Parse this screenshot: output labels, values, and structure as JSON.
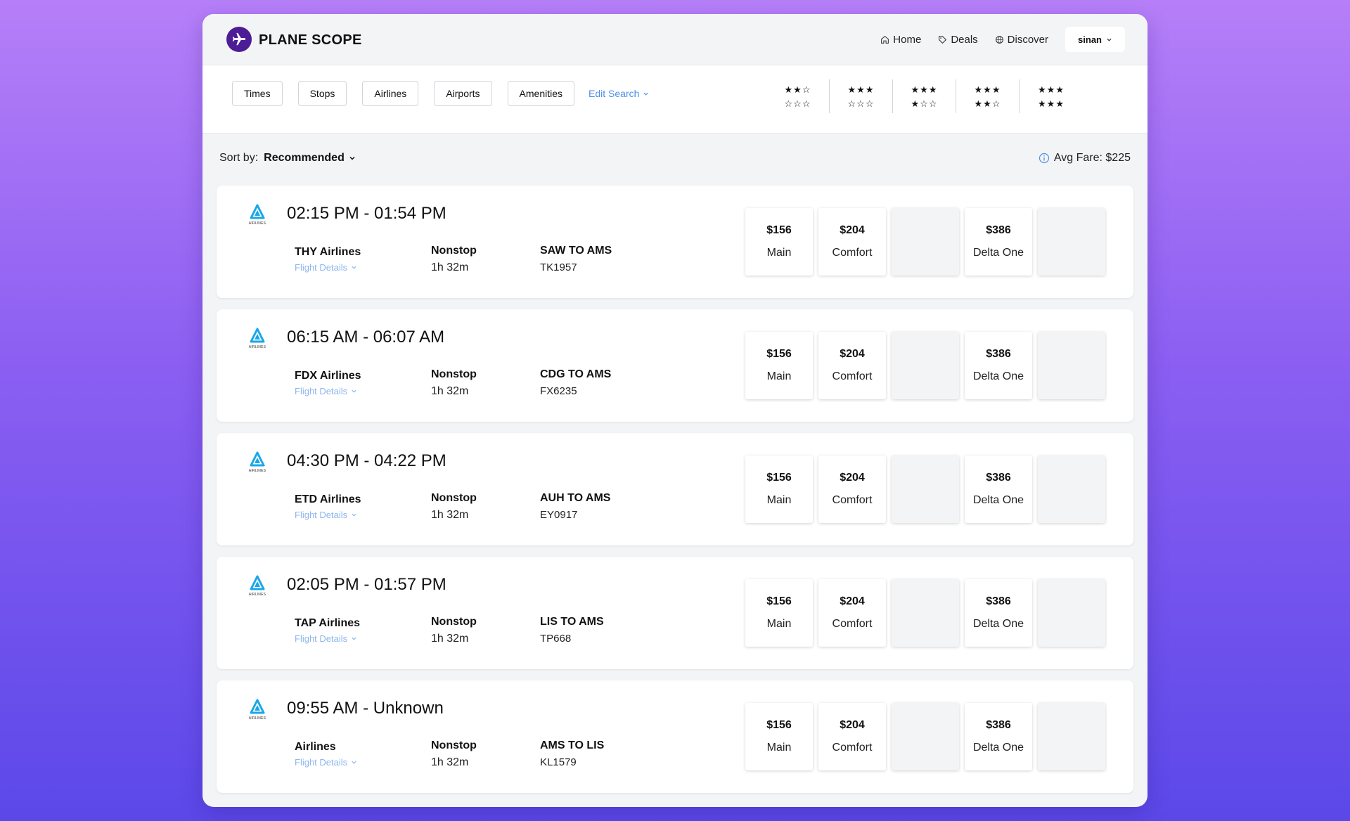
{
  "app": {
    "brand": "PLANE SCOPE"
  },
  "nav": {
    "home": "Home",
    "deals": "Deals",
    "discover": "Discover",
    "user": "sinan"
  },
  "filters": {
    "times": "Times",
    "stops": "Stops",
    "airlines": "Airlines",
    "airports": "Airports",
    "amenities": "Amenities",
    "edit_search": "Edit Search"
  },
  "star_ratings": [
    {
      "top": "★★☆",
      "bottom": "☆☆☆"
    },
    {
      "top": "★★★",
      "bottom": "☆☆☆"
    },
    {
      "top": "★★★",
      "bottom": "★☆☆"
    },
    {
      "top": "★★★",
      "bottom": "★★☆"
    },
    {
      "top": "★★★",
      "bottom": "★★★"
    }
  ],
  "sort": {
    "label": "Sort by:",
    "value": "Recommended"
  },
  "avg_fare": "Avg Fare: $225",
  "logo_text": "AIRLINES",
  "flight_details_label": "Flight Details",
  "flights": [
    {
      "time": "02:15 PM - 01:54 PM",
      "airline": "THY Airlines",
      "stops": "Nonstop",
      "duration": "1h 32m",
      "route": "SAW TO AMS",
      "flight_no": "TK1957",
      "fares": [
        {
          "price": "$156",
          "cls": "Main"
        },
        {
          "price": "$204",
          "cls": "Comfort"
        },
        {
          "price": "",
          "cls": ""
        },
        {
          "price": "$386",
          "cls": "Delta One"
        },
        {
          "price": "",
          "cls": ""
        }
      ]
    },
    {
      "time": "06:15 AM - 06:07 AM",
      "airline": "FDX Airlines",
      "stops": "Nonstop",
      "duration": "1h 32m",
      "route": "CDG TO AMS",
      "flight_no": "FX6235",
      "fares": [
        {
          "price": "$156",
          "cls": "Main"
        },
        {
          "price": "$204",
          "cls": "Comfort"
        },
        {
          "price": "",
          "cls": ""
        },
        {
          "price": "$386",
          "cls": "Delta One"
        },
        {
          "price": "",
          "cls": ""
        }
      ]
    },
    {
      "time": "04:30 PM - 04:22 PM",
      "airline": "ETD Airlines",
      "stops": "Nonstop",
      "duration": "1h 32m",
      "route": "AUH TO AMS",
      "flight_no": "EY0917",
      "fares": [
        {
          "price": "$156",
          "cls": "Main"
        },
        {
          "price": "$204",
          "cls": "Comfort"
        },
        {
          "price": "",
          "cls": ""
        },
        {
          "price": "$386",
          "cls": "Delta One"
        },
        {
          "price": "",
          "cls": ""
        }
      ]
    },
    {
      "time": "02:05 PM - 01:57 PM",
      "airline": "TAP Airlines",
      "stops": "Nonstop",
      "duration": "1h 32m",
      "route": "LIS TO AMS",
      "flight_no": "TP668",
      "fares": [
        {
          "price": "$156",
          "cls": "Main"
        },
        {
          "price": "$204",
          "cls": "Comfort"
        },
        {
          "price": "",
          "cls": ""
        },
        {
          "price": "$386",
          "cls": "Delta One"
        },
        {
          "price": "",
          "cls": ""
        }
      ]
    },
    {
      "time": "09:55 AM - Unknown",
      "airline": "Airlines",
      "stops": "Nonstop",
      "duration": "1h 32m",
      "route": "AMS TO LIS",
      "flight_no": "KL1579",
      "fares": [
        {
          "price": "$156",
          "cls": "Main"
        },
        {
          "price": "$204",
          "cls": "Comfort"
        },
        {
          "price": "",
          "cls": ""
        },
        {
          "price": "$386",
          "cls": "Delta One"
        },
        {
          "price": "",
          "cls": ""
        }
      ]
    }
  ],
  "colors": {
    "brand": "#4c1d95",
    "link": "#4f8fe6",
    "logo": "#19a7e8"
  }
}
